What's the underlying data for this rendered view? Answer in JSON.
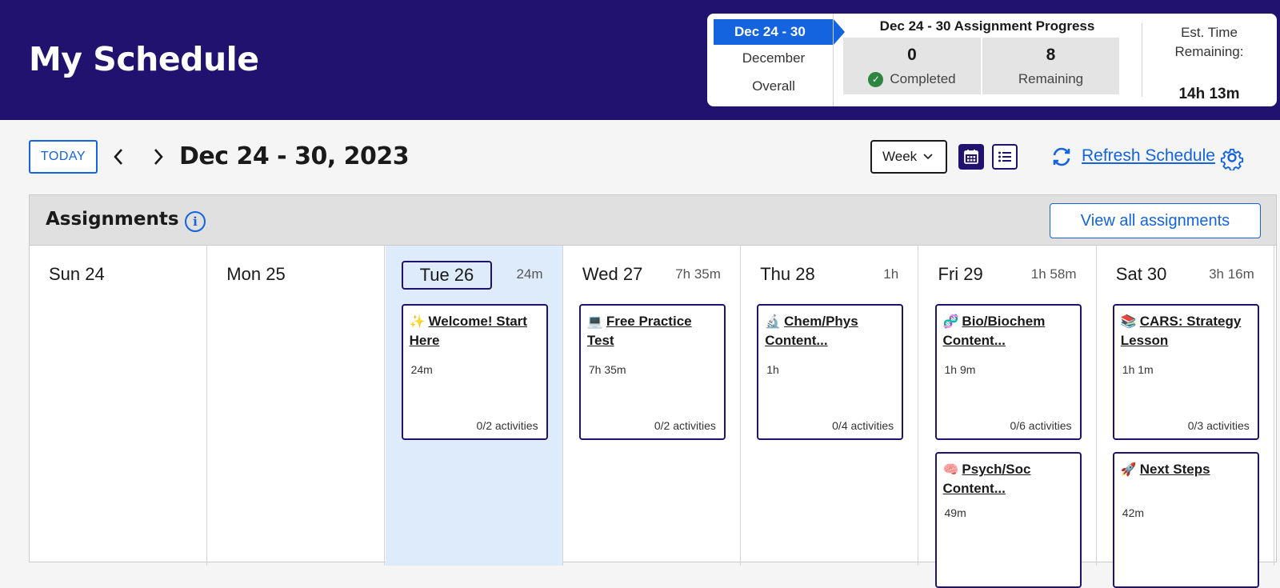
{
  "header": {
    "title": "My Schedule",
    "progress": {
      "tabs": [
        "Dec 24 - 30",
        "December",
        "Overall"
      ],
      "title": "Dec 24 - 30 Assignment Progress",
      "completed_count": "0",
      "completed_label": "Completed",
      "remaining_count": "8",
      "remaining_label": "Remaining",
      "est_label_line1": "Est. Time",
      "est_label_line2": "Remaining:",
      "est_value": "14h 13m"
    }
  },
  "toolbar": {
    "today_label": "TODAY",
    "range_title": "Dec 24 - 30, 2023",
    "view_select": "Week",
    "refresh_label": "Refresh Schedule"
  },
  "assignments": {
    "title": "Assignments",
    "info_glyph": "i",
    "view_all_label": "View all assignments",
    "days": [
      {
        "label": "Sun 24",
        "duration": "",
        "cards": []
      },
      {
        "label": "Mon 25",
        "duration": "",
        "cards": []
      },
      {
        "label": "Tue 26",
        "duration": "24m",
        "cards": [
          {
            "emoji": "✨",
            "title": "Welcome! Start Here",
            "time": "24m",
            "activities": "0/2 activities"
          }
        ]
      },
      {
        "label": "Wed 27",
        "duration": "7h 35m",
        "cards": [
          {
            "emoji": "💻",
            "title": "Free Practice Test",
            "time": "7h 35m",
            "activities": "0/2 activities"
          }
        ]
      },
      {
        "label": "Thu 28",
        "duration": "1h",
        "cards": [
          {
            "emoji": "🔬",
            "title": "Chem/Phys Content...",
            "time": "1h",
            "activities": "0/4 activities"
          }
        ]
      },
      {
        "label": "Fri 29",
        "duration": "1h 58m",
        "cards": [
          {
            "emoji": "🧬",
            "title": "Bio/Biochem Content...",
            "time": "1h 9m",
            "activities": "0/6 activities"
          },
          {
            "emoji": "🧠",
            "title": "Psych/Soc Content...",
            "time": "49m",
            "activities": ""
          }
        ]
      },
      {
        "label": "Sat 30",
        "duration": "3h 16m",
        "cards": [
          {
            "emoji": "📚",
            "title": "CARS: Strategy Lesson",
            "time": "1h 1m",
            "activities": "0/3 activities"
          },
          {
            "emoji": "🚀",
            "title": "Next Steps",
            "time": "42m",
            "activities": ""
          }
        ]
      }
    ]
  },
  "colors": {
    "header_bg": "#221270",
    "accent": "#1464e0",
    "today_bg": "#deebfb",
    "completed_green": "#2e8540"
  },
  "icons": [
    "chevron-left-icon",
    "chevron-right-icon",
    "calendar-icon",
    "list-icon",
    "refresh-icon",
    "gear-icon",
    "info-icon",
    "check-circle-icon"
  ]
}
